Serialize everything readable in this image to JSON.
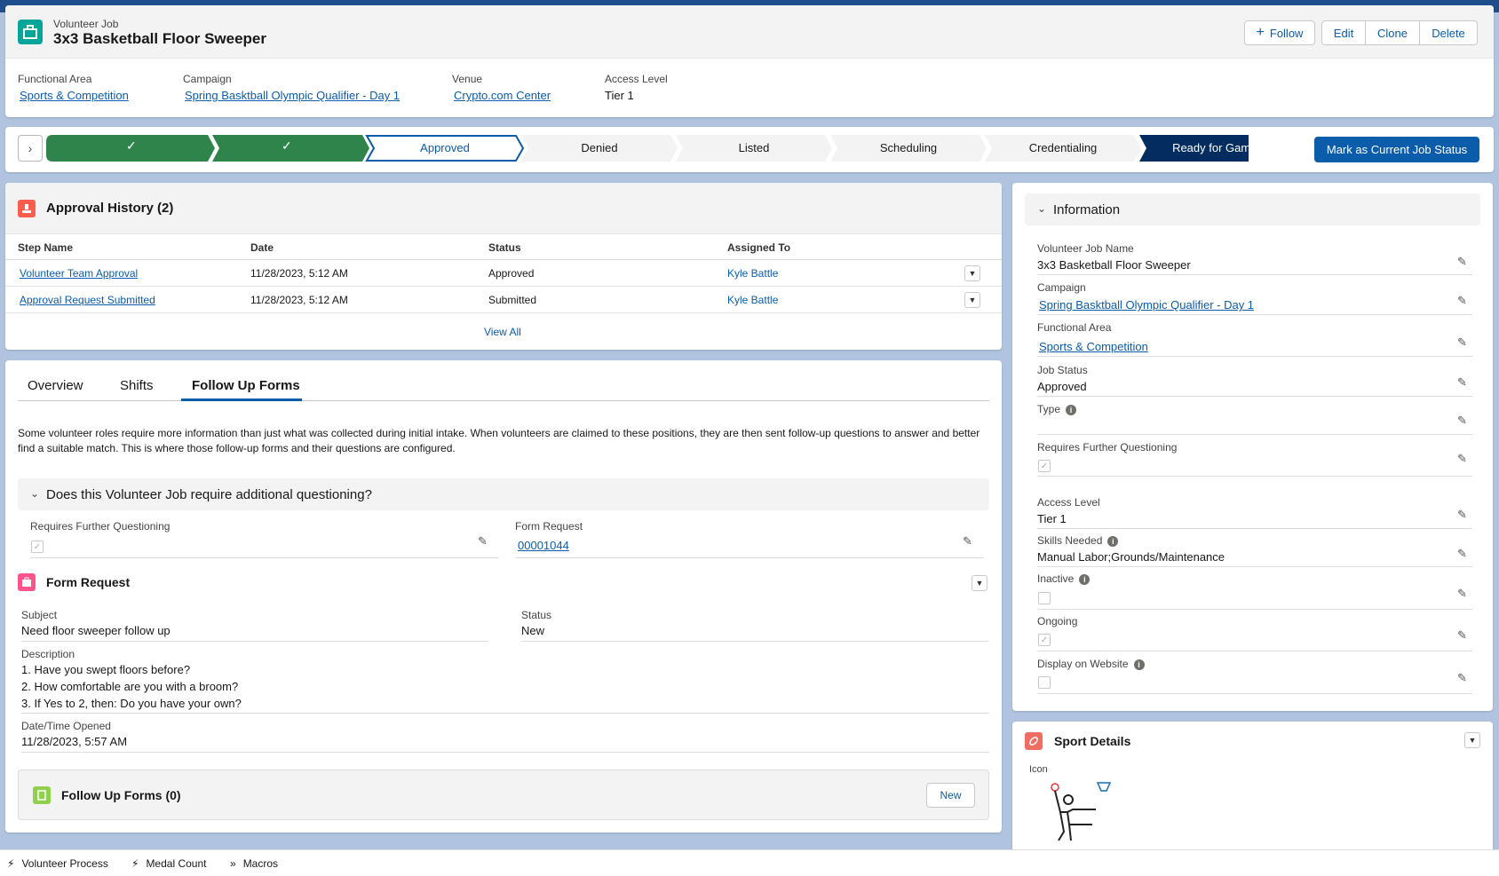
{
  "record": {
    "object_type": "Volunteer Job",
    "title": "3x3 Basketball Floor Sweeper",
    "actions": {
      "follow": "Follow",
      "edit": "Edit",
      "clone": "Clone",
      "delete": "Delete"
    },
    "highlights": [
      {
        "label": "Functional Area",
        "value": "Sports & Competition"
      },
      {
        "label": "Campaign",
        "value": "Spring Basktball Olympic Qualifier - Day 1"
      },
      {
        "label": "Venue",
        "value": "Crypto.com Center"
      },
      {
        "label": "Access Level",
        "value": "Tier 1"
      }
    ]
  },
  "path": {
    "steps": [
      "",
      "",
      "Approved",
      "Denied",
      "Listed",
      "Scheduling",
      "Credentialing",
      "Ready for Games"
    ],
    "mark_button": "Mark as Current Job Status"
  },
  "approval": {
    "title": "Approval History (2)",
    "columns": [
      "Step Name",
      "Date",
      "Status",
      "Assigned To"
    ],
    "rows": [
      [
        "Volunteer Team Approval",
        "11/28/2023, 5:12 AM",
        "Approved",
        "Kyle Battle"
      ],
      [
        "Approval Request Submitted",
        "11/28/2023, 5:12 AM",
        "Submitted",
        "Kyle Battle"
      ]
    ],
    "view_all": "View All"
  },
  "tabs": [
    "Overview",
    "Shifts",
    "Follow Up Forms"
  ],
  "follow": {
    "description": "Some volunteer roles require more information than just what was collected during initial intake. When volunteers are claimed to these positions, they are then sent follow-up questions to answer and better find a suitable match. This is where those follow-up forms and their questions are configured.",
    "section_title": "Does this Volunteer Job require additional questioning?",
    "req_label": "Requires Further Questioning",
    "form_request_label": "Form Request",
    "form_request_value": "00001044",
    "form_card_title": "Form Request",
    "subject_label": "Subject",
    "subject_value": "Need floor sweeper follow up",
    "status_label": "Status",
    "status_value": "New",
    "desc_label": "Description",
    "desc_lines": [
      "1. Have you swept floors before?",
      "2. How comfortable are you with a broom?",
      "3. If Yes to 2, then: Do you have your own?"
    ],
    "opened_label": "Date/Time Opened",
    "opened_value": "11/28/2023, 5:57 AM",
    "followup_title": "Follow Up Forms (0)",
    "new_button": "New"
  },
  "info": {
    "title": "Information",
    "fields": {
      "job_name_label": "Volunteer Job Name",
      "job_name": "3x3 Basketball Floor Sweeper",
      "campaign_label": "Campaign",
      "campaign": "Spring Basktball Olympic Qualifier - Day 1",
      "fa_label": "Functional Area",
      "fa": "Sports & Competition",
      "status_label": "Job Status",
      "status": "Approved",
      "type_label": "Type",
      "rfq_label": "Requires Further Questioning",
      "access_label": "Access Level",
      "access": "Tier 1",
      "skills_label": "Skills Needed",
      "skills": "Manual Labor;Grounds/Maintenance",
      "inactive_label": "Inactive",
      "ongoing_label": "Ongoing",
      "display_label": "Display on Website"
    }
  },
  "sport": {
    "title": "Sport Details",
    "icon_label": "Icon"
  },
  "footer": [
    "Volunteer Process",
    "Medal Count",
    "Macros"
  ],
  "colors": {
    "brand": "#0b5cab",
    "complete": "#2e844a",
    "current_navy": "#032d60",
    "job_icon": "#06a59a",
    "approval_icon": "#fe5c4c"
  }
}
